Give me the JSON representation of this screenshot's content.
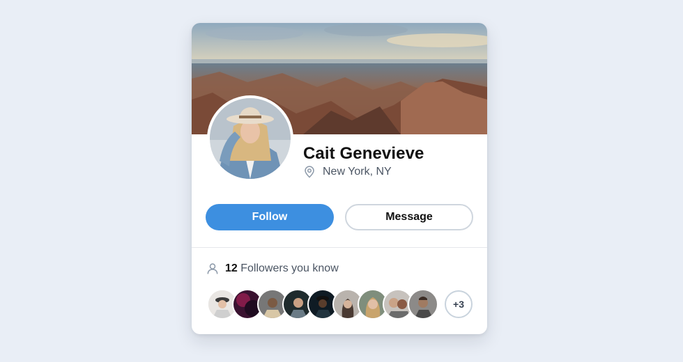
{
  "profile": {
    "name": "Cait Genevieve",
    "location": "New York, NY",
    "location_icon": "map-pin-icon"
  },
  "actions": {
    "follow_label": "Follow",
    "message_label": "Message"
  },
  "followers": {
    "icon": "person-icon",
    "count": "12",
    "label": "Followers you know",
    "more_label": "+3"
  },
  "colors": {
    "accent": "#3d8fe0",
    "background": "#e9eef6"
  }
}
